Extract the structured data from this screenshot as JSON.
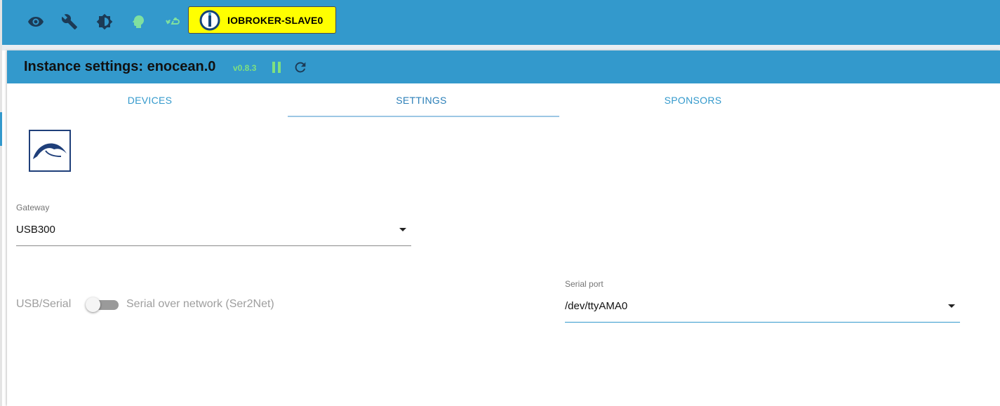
{
  "topbar": {
    "icons": [
      "eye-icon",
      "wrench-icon",
      "brightness-icon",
      "head-icon",
      "cloud-sync-icon"
    ],
    "host_name": "IOBROKER-SLAVE0",
    "background": "#3399cc",
    "badge_color": "#ffff00"
  },
  "card": {
    "title": "Instance settings: enocean.0",
    "version": "v0.8.3",
    "pause_icon": "pause-icon",
    "reload_icon": "reload-icon",
    "header_color": "#3399cc",
    "status_color": "#7fe07f"
  },
  "tabs": [
    {
      "label": "DEVICES",
      "active": false
    },
    {
      "label": "SETTINGS",
      "active": true
    },
    {
      "label": "SPONSORS",
      "active": false
    }
  ],
  "form": {
    "gateway": {
      "label": "Gateway",
      "value": "USB300"
    },
    "toggle": {
      "left_label": "USB/Serial",
      "right_label": "Serial over network (Ser2Net)",
      "checked": false
    },
    "serial_port": {
      "label": "Serial port",
      "value": "/dev/ttyAMA0"
    }
  }
}
